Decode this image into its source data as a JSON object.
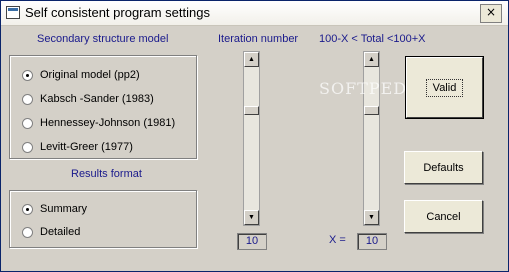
{
  "window": {
    "title": "Self consistent program settings",
    "close_glyph": "×"
  },
  "structure": {
    "title": "Secondary structure model",
    "options": [
      {
        "label": "Original model (pp2)",
        "checked": true
      },
      {
        "label": "Kabsch -Sander (1983)",
        "checked": false
      },
      {
        "label": "Hennessey-Johnson (1981)",
        "checked": false
      },
      {
        "label": "Levitt-Greer (1977)",
        "checked": false
      }
    ]
  },
  "results": {
    "title": "Results format",
    "options": [
      {
        "label": "Summary",
        "checked": true
      },
      {
        "label": "Detailed",
        "checked": false
      }
    ]
  },
  "iteration": {
    "label": "Iteration number",
    "value": "10"
  },
  "total": {
    "label": "100-X < Total <100+X",
    "x_label": "X =",
    "value": "10"
  },
  "buttons": {
    "valid": "Valid",
    "defaults": "Defaults",
    "cancel": "Cancel"
  },
  "watermark": "SOFTPEDIA",
  "icons": {
    "scroll_up": "▲",
    "scroll_down": "▼"
  }
}
